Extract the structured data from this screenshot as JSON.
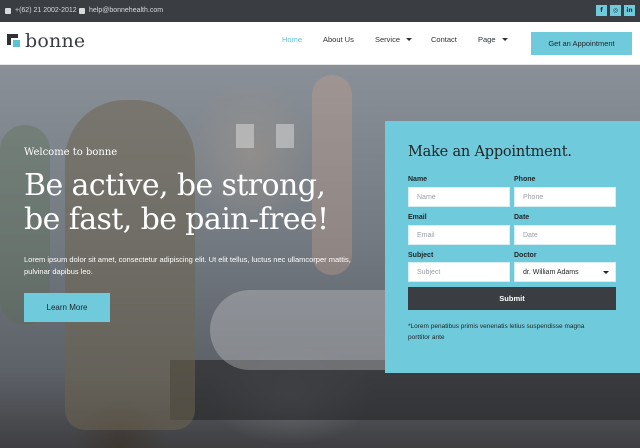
{
  "topbar": {
    "phone": "+(62) 21 2002-2012",
    "email": "help@bonnehealth.com",
    "socials": [
      {
        "name": "facebook-icon",
        "glyph": "f"
      },
      {
        "name": "instagram-icon",
        "glyph": "◎"
      },
      {
        "name": "linkedin-icon",
        "glyph": "in"
      }
    ]
  },
  "header": {
    "logo_text": "bonne",
    "nav": [
      {
        "label": "Home",
        "active": true,
        "dropdown": false
      },
      {
        "label": "About Us",
        "active": false,
        "dropdown": false
      },
      {
        "label": "Service",
        "active": false,
        "dropdown": true
      },
      {
        "label": "Contact",
        "active": false,
        "dropdown": false
      },
      {
        "label": "Page",
        "active": false,
        "dropdown": true
      }
    ],
    "cta_label": "Get an Appointment"
  },
  "hero": {
    "welcome": "Welcome to bonne",
    "headline": "Be active, be strong, be fast, be pain-free!",
    "description": "Lorem ipsum dolor sit amet, consectetur adipiscing elit. Ut elit tellus, luctus nec ullamcorper mattis, pulvinar dapibus leo.",
    "button_label": "Learn More"
  },
  "appointment": {
    "title": "Make an Appointment.",
    "name_label": "Name",
    "name_placeholder": "Name",
    "phone_label": "Phone",
    "phone_placeholder": "Phone",
    "email_label": "Email",
    "email_placeholder": "Email",
    "date_label": "Date",
    "date_placeholder": "Date",
    "subject_label": "Subject",
    "subject_placeholder": "Subject",
    "doctor_label": "Doctor",
    "doctor_value": "dr. William Adams",
    "submit_label": "Submit",
    "note": "*Lorem penatibus primis venenatis letius suspendisse magna porttitor ante"
  },
  "colors": {
    "accent": "#6fcbdc",
    "dark": "#3a3d42"
  }
}
